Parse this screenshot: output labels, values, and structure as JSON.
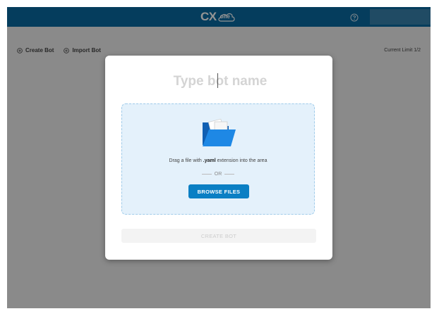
{
  "header": {
    "logo_cx": "CX",
    "logo_one": "one",
    "help_icon": "help-circle-icon",
    "brand_color": "#0a6aa1"
  },
  "toolbar": {
    "create_bot_label": "Create Bot",
    "import_bot_label": "Import Bot",
    "current_limit": "Current Limit 1/2"
  },
  "modal": {
    "name_placeholder": "Type bot name",
    "dropzone": {
      "icon": "folder-icon",
      "drag_prefix": "Drag a file with ",
      "drag_ext": ".yaml",
      "drag_suffix": " extension into the area",
      "or_label": "OR",
      "browse_label": "BROWSE FILES"
    },
    "create_label": "CREATE BOT",
    "accent_color": "#0a7fc4"
  }
}
